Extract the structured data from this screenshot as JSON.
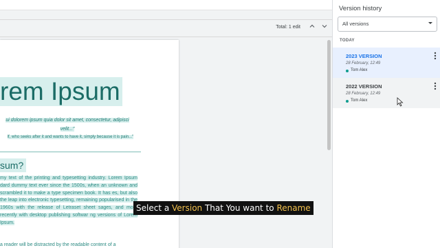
{
  "editor": {
    "edit_count": "Total: 1 edit",
    "up_icon": "chevron-up-icon",
    "down_icon": "chevron-down-icon"
  },
  "document": {
    "title": "rem Ipsum",
    "subtitle_line1": "ui dolorem ipsum quia dolor sit amet, consectetur, adipisci",
    "subtitle_line2": "velit...\"",
    "subtitle_line3": "lf, who seeks after it and wants to have it, simply because it is pain...\"",
    "heading2": "sum?",
    "paragraph": "my text of the printing and typesetting industry. Lorem Ipsum dard dummy text ever since the 1500s, when an unknown and scrambled it to make a type specimen book. It has es, but also the leap into electronic typesetting, remaining popularised in the 1960s with the release of Letraset sheet sages, and more recently with desktop publishing softwar ng versions of Lorem Ipsum.",
    "paragraph2": "a reader will be distracted by the readable content of a"
  },
  "sidebar": {
    "title": "Version history",
    "filter": "All versions",
    "group_label": "TODAY",
    "versions": [
      {
        "name": "2023 VERSION",
        "date": "28 February, 12:49",
        "user": "Tom Alex",
        "name_color": "#1a73e8",
        "state": "selected"
      },
      {
        "name": "2022 VERSION",
        "date": "28 February, 12:49",
        "user": "Tom Alex",
        "name_color": "#3c4043",
        "state": "hover"
      }
    ]
  },
  "caption": {
    "part1": "Select a ",
    "part2": "Version",
    "part3": " That You want to ",
    "part4": "Rename",
    "highlight_color": "#f2c14e"
  }
}
